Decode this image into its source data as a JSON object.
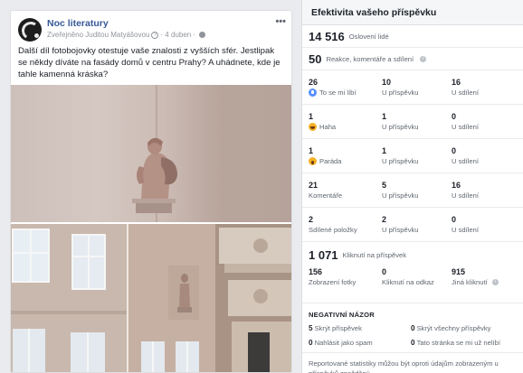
{
  "post": {
    "page_name": "Noc literatury",
    "published_by": "Zveřejněno Juditou Matyášovou",
    "date": "· 4 duben ·",
    "text": "Další díl fotobojovky otestuje vaše znalosti z vyšších sfér. Jestlipak se někdy díváte na fasády domů v centru Prahy? A uhádnete, kde je tahle kamenná kráska?"
  },
  "stats": {
    "title": "Efektivita vašeho příspěvku",
    "reached": {
      "value": "14 516",
      "label": "Oslovení lidé"
    },
    "engagement": {
      "value": "50",
      "label": "Reakce, komentáře a sdílení"
    },
    "rows": [
      {
        "icon": "like-icon",
        "total": "26",
        "total_label": "To se mi líbí",
        "on_post": "10",
        "on_post_label": "U příspěvku",
        "on_shares": "16",
        "on_shares_label": "U sdílení"
      },
      {
        "icon": "haha-icon",
        "total": "1",
        "total_label": "Haha",
        "on_post": "1",
        "on_post_label": "U příspěvku",
        "on_shares": "0",
        "on_shares_label": "U sdílení"
      },
      {
        "icon": "wow-icon",
        "total": "1",
        "total_label": "Paráda",
        "on_post": "1",
        "on_post_label": "U příspěvku",
        "on_shares": "0",
        "on_shares_label": "U sdílení"
      },
      {
        "icon": "",
        "total": "21",
        "total_label": "Komentáře",
        "on_post": "5",
        "on_post_label": "U příspěvku",
        "on_shares": "16",
        "on_shares_label": "U sdílení"
      },
      {
        "icon": "",
        "total": "2",
        "total_label": "Sdílené položky",
        "on_post": "2",
        "on_post_label": "U příspěvku",
        "on_shares": "0",
        "on_shares_label": "U sdílení"
      }
    ],
    "clicks": {
      "value": "1 071",
      "label": "Kliknutí na příspěvek",
      "photo": {
        "value": "156",
        "label": "Zobrazení fotky"
      },
      "link": {
        "value": "0",
        "label": "Kliknutí na odkaz"
      },
      "other": {
        "value": "915",
        "label": "Jiná kliknutí"
      }
    },
    "negative": {
      "title": "NEGATIVNÍ NÁZOR",
      "hide_post": {
        "value": "5",
        "label": "Skrýt příspěvek"
      },
      "hide_all": {
        "value": "0",
        "label": "Skrýt všechny příspěvky"
      },
      "report_spam": {
        "value": "0",
        "label": "Nahlásit jako spam"
      },
      "unlike_page": {
        "value": "0",
        "label": "Tato stránka se mi už nelíbí"
      }
    },
    "footer": "Reportované statistiky můžou být oproti údajům zobrazeným u příspěvků zpožděný."
  }
}
